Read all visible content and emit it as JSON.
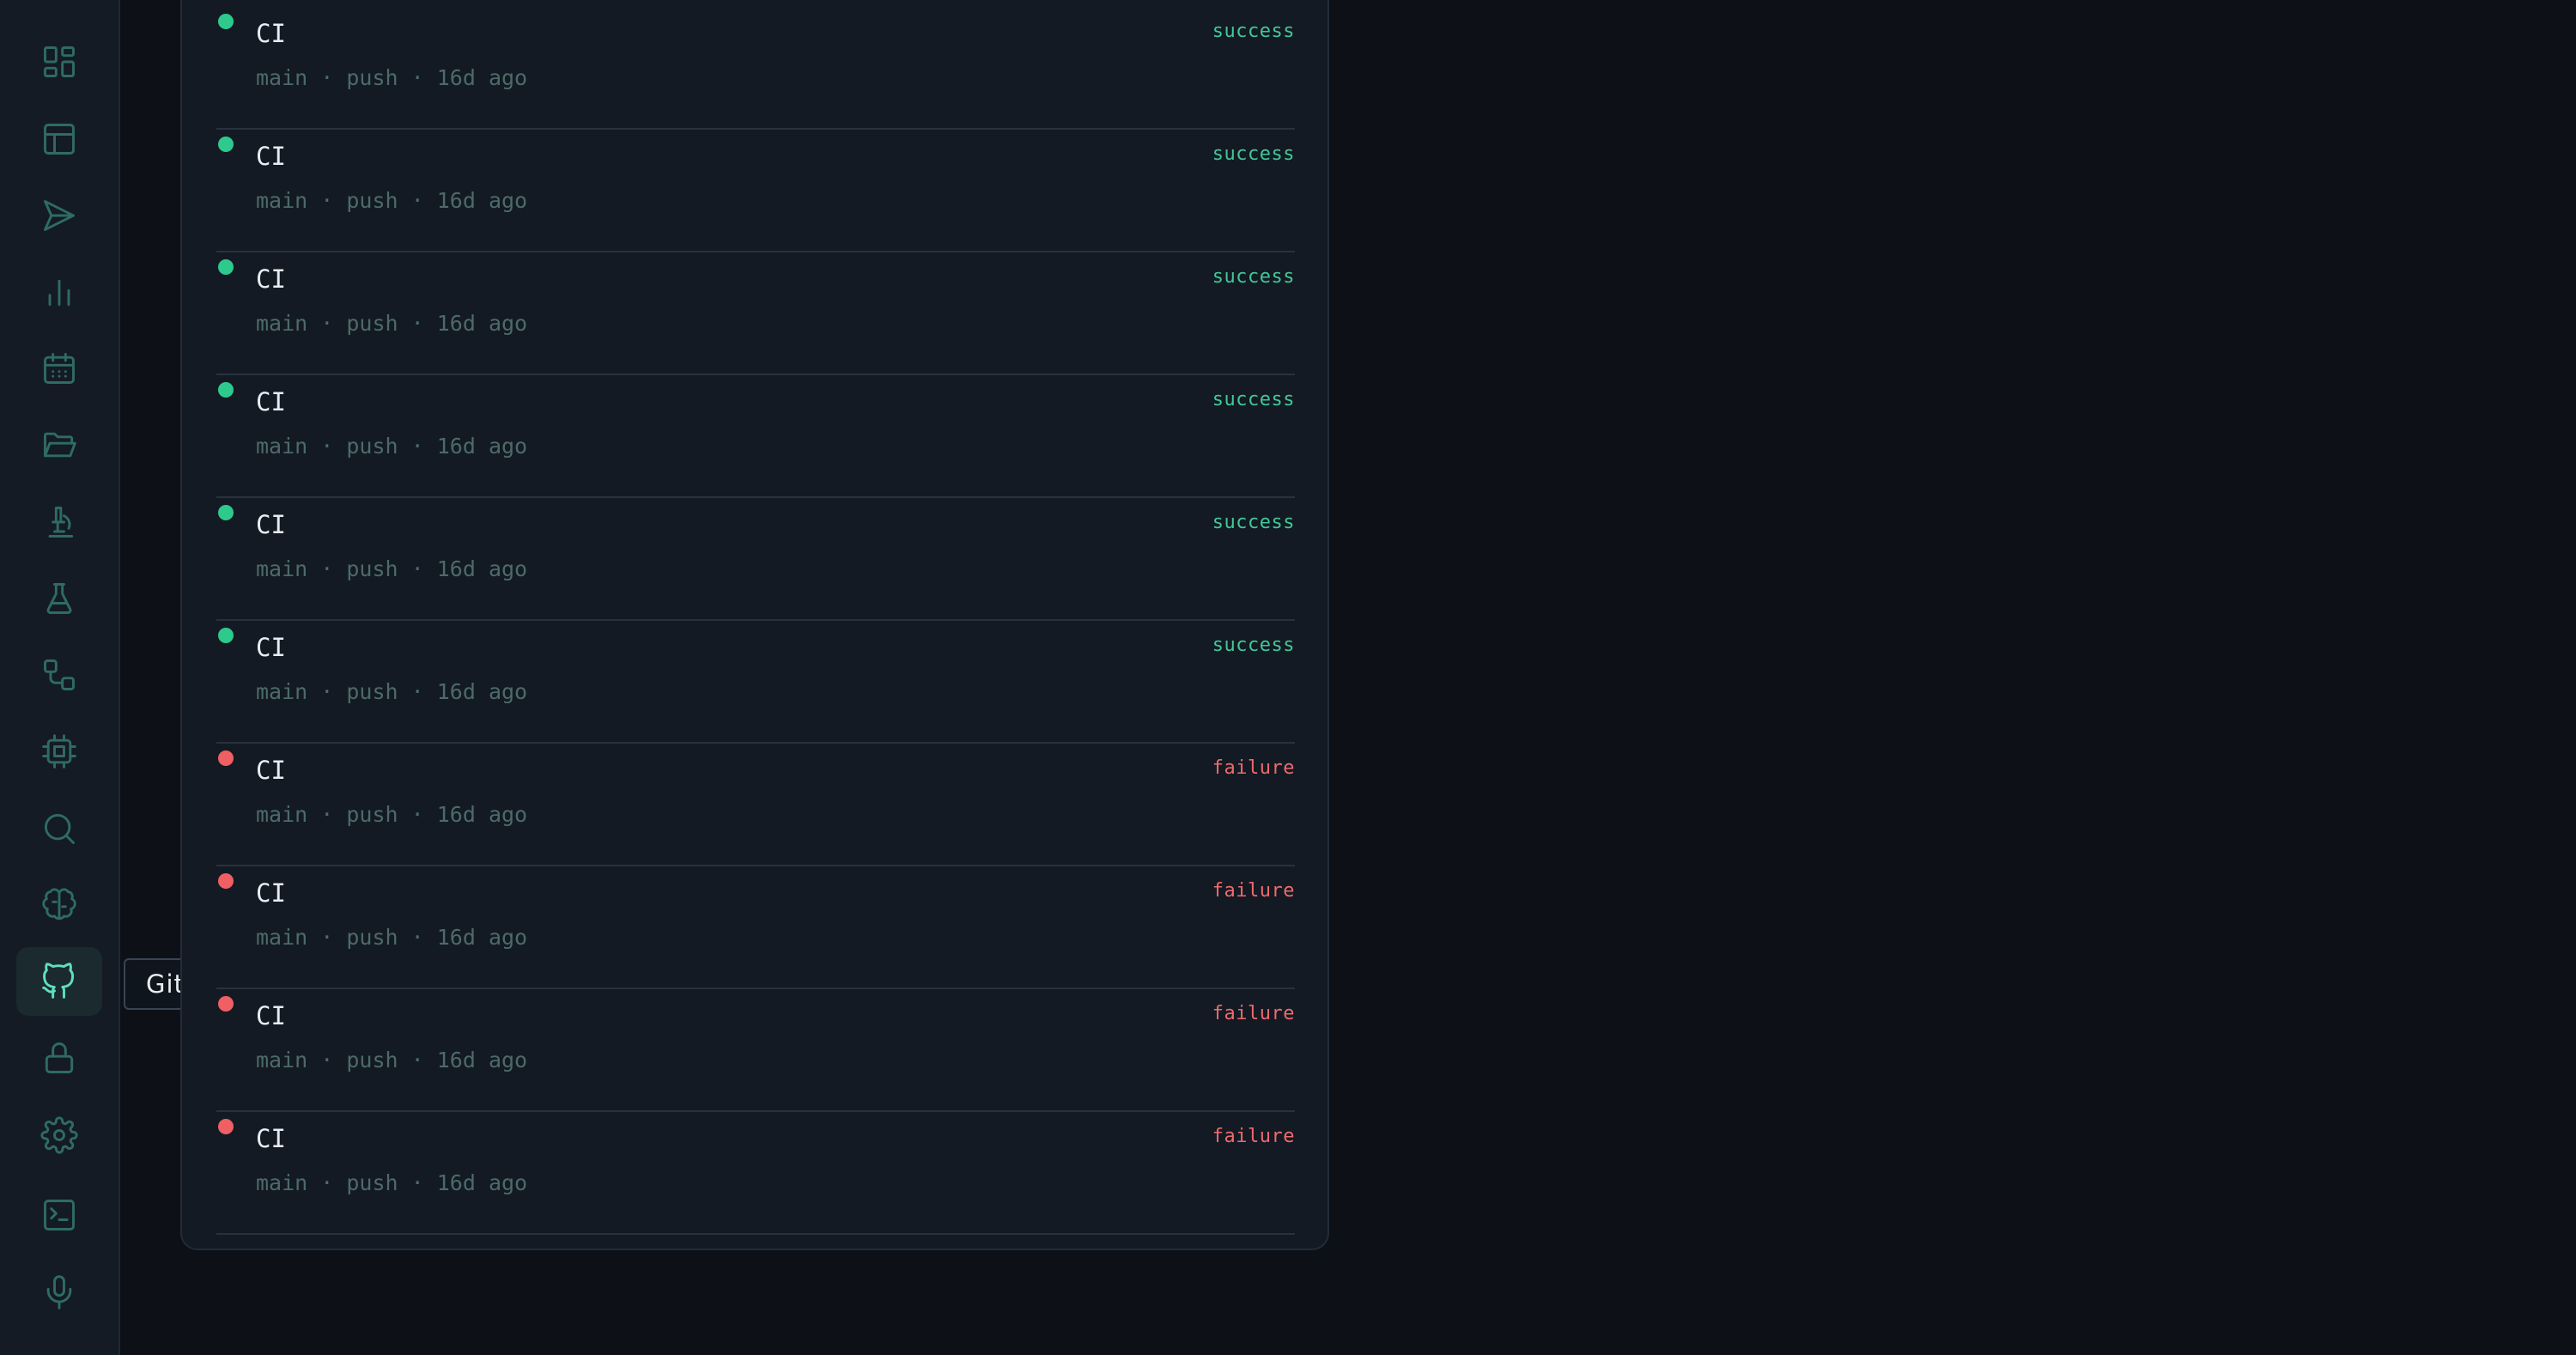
{
  "sidebar": {
    "items": [
      {
        "icon": "dashboard-icon"
      },
      {
        "icon": "table-icon"
      },
      {
        "icon": "send-icon"
      },
      {
        "icon": "bar-chart-icon"
      },
      {
        "icon": "calendar-icon"
      },
      {
        "icon": "folder-open-icon"
      },
      {
        "icon": "microscope-icon"
      },
      {
        "icon": "flask-icon"
      },
      {
        "icon": "workflow-icon"
      },
      {
        "icon": "cpu-icon"
      },
      {
        "icon": "search-icon"
      },
      {
        "icon": "brain-icon"
      },
      {
        "icon": "github-icon",
        "active": true
      },
      {
        "icon": "lock-icon"
      },
      {
        "icon": "settings-icon"
      },
      {
        "icon": "terminal-icon"
      },
      {
        "icon": "microphone-icon"
      }
    ],
    "tooltip": "GitHub"
  },
  "runs": [
    {
      "name": "CI",
      "branch": "main",
      "event": "push",
      "age": "16d ago",
      "status": "success"
    },
    {
      "name": "CI",
      "branch": "main",
      "event": "push",
      "age": "16d ago",
      "status": "success"
    },
    {
      "name": "CI",
      "branch": "main",
      "event": "push",
      "age": "16d ago",
      "status": "success"
    },
    {
      "name": "CI",
      "branch": "main",
      "event": "push",
      "age": "16d ago",
      "status": "success"
    },
    {
      "name": "CI",
      "branch": "main",
      "event": "push",
      "age": "16d ago",
      "status": "success"
    },
    {
      "name": "CI",
      "branch": "main",
      "event": "push",
      "age": "16d ago",
      "status": "success"
    },
    {
      "name": "CI",
      "branch": "main",
      "event": "push",
      "age": "16d ago",
      "status": "failure"
    },
    {
      "name": "CI",
      "branch": "main",
      "event": "push",
      "age": "16d ago",
      "status": "failure"
    },
    {
      "name": "CI",
      "branch": "main",
      "event": "push",
      "age": "16d ago",
      "status": "failure"
    },
    {
      "name": "CI",
      "branch": "main",
      "event": "push",
      "age": "16d ago",
      "status": "failure"
    }
  ],
  "colors": {
    "success": "#2ec98d",
    "failure": "#ef5f63",
    "accent": "#5fe0bd"
  }
}
